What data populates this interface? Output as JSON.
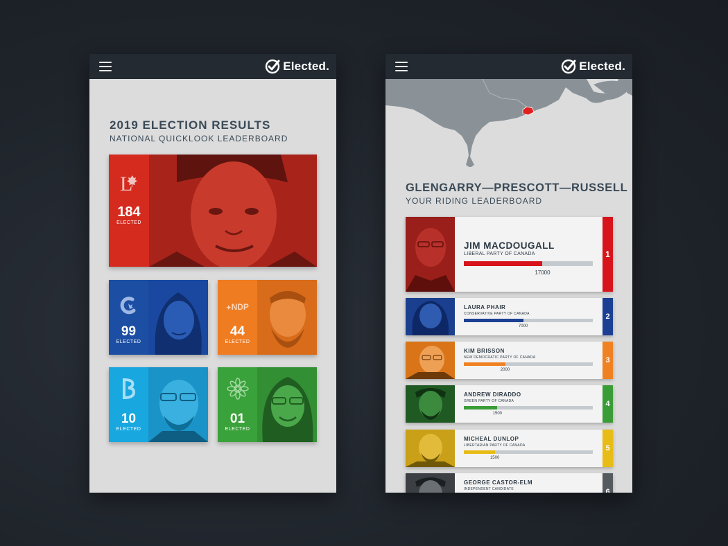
{
  "brand": {
    "name": "Elected."
  },
  "leaderboard": {
    "title": "2019 ELECTION RESULTS",
    "subtitle": "NATIONAL QUICKLOOK LEADERBOARD",
    "elected_label": "ELECTED",
    "parties": [
      {
        "id": "liberal",
        "count": "184",
        "logo_text": "L",
        "color": "#d52a1e",
        "photo_tint": "#b3261b"
      },
      {
        "id": "conservative",
        "count": "99",
        "logo_text": "C",
        "color": "#1c4fa3",
        "photo_tint": "#1a48a0"
      },
      {
        "id": "ndp",
        "count": "44",
        "logo_text": "NDP",
        "color": "#f07c22",
        "photo_tint": "#d96c1a"
      },
      {
        "id": "bloc",
        "count": "10",
        "logo_text": "B",
        "color": "#19a7e0",
        "photo_tint": "#1a93c8"
      },
      {
        "id": "green",
        "count": "01",
        "logo_text": "",
        "color": "#3aa23a",
        "photo_tint": "#338f34"
      }
    ]
  },
  "riding": {
    "title": "GLENGARRY—PRESCOTT—RUSSELL",
    "subtitle": "YOUR RIDING LEADERBOARD",
    "map_highlight_color": "#e02020",
    "candidates": [
      {
        "rank": "1",
        "name": "JIM MACDOUGALL",
        "party": "LIBERAL PARTY OF CANADA",
        "votes": "17000",
        "bar_fraction": 0.61,
        "color": "#d7141c"
      },
      {
        "rank": "2",
        "name": "LAURA PHAIR",
        "party": "CONSERVATIVE PARTY OF CANADA",
        "votes": "7000",
        "bar_fraction": 0.46,
        "color": "#1b3f93"
      },
      {
        "rank": "3",
        "name": "KIM BRISSON",
        "party": "NEW DEMOCRATIC PARTY OF CANADA",
        "votes": "2000",
        "bar_fraction": 0.32,
        "color": "#f08123"
      },
      {
        "rank": "4",
        "name": "ANDREW DIRADDO",
        "party": "GREEN PARTY OF CANADA",
        "votes": "1500",
        "bar_fraction": 0.26,
        "color": "#3a9c36"
      },
      {
        "rank": "5",
        "name": "MICHEAL DUNLOP",
        "party": "LIBERTARIAN PARTY OF CANADA",
        "votes": "1500",
        "bar_fraction": 0.24,
        "color": "#e8bc17"
      },
      {
        "rank": "6",
        "name": "GEORGE CASTOR-ELM",
        "party": "INDEPENDENT CANDIDATE",
        "votes": "",
        "bar_fraction": 0,
        "color": "#555a5e"
      }
    ]
  }
}
